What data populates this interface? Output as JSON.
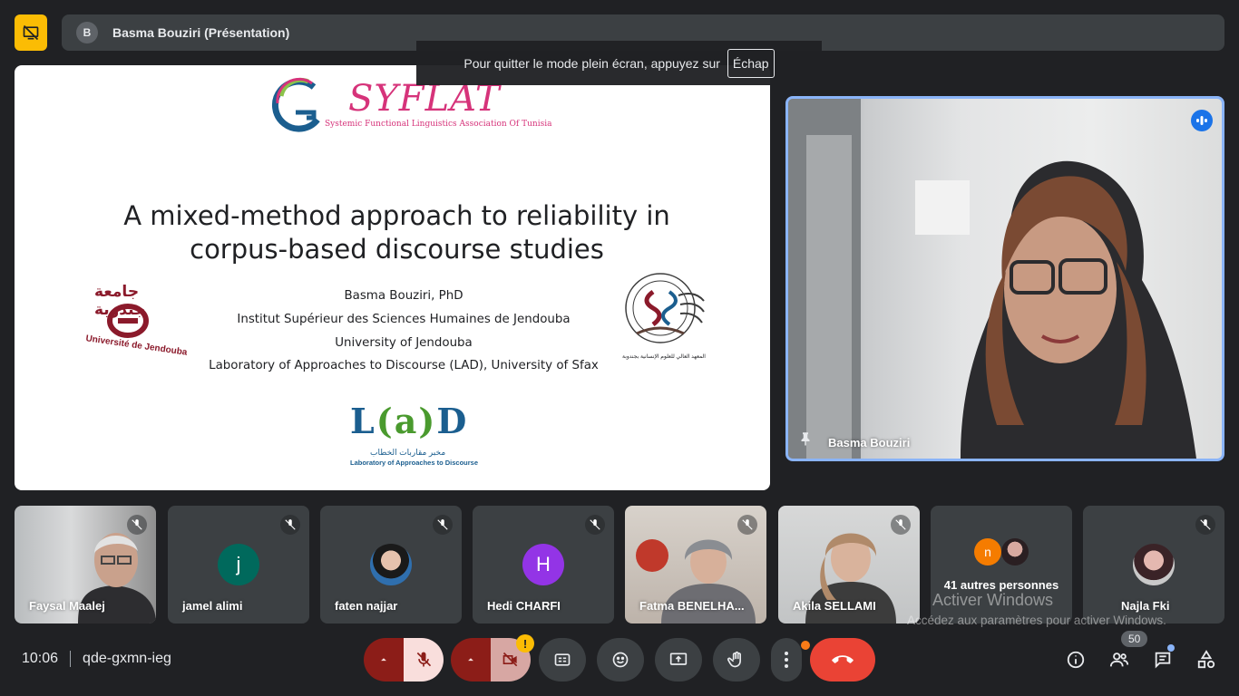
{
  "header": {
    "presenter_initial": "B",
    "presentation_title": "Basma Bouziri (Présentation)"
  },
  "fullscreen_toast": {
    "message": "Pour quitter le mode plein écran, appuyez sur",
    "key": "Échap"
  },
  "slide": {
    "logo_syflat_word": "SYFLAT",
    "logo_syflat_sub": "Systemic Functional Linguistics Association Of Tunisia",
    "title_line1": "A mixed-method approach to reliability in",
    "title_line2": "corpus-based discourse studies",
    "author": "Basma Bouziri, PhD",
    "affiliation1": "Institut Supérieur des Sciences Humaines de Jendouba",
    "affiliation2": "University of Jendouba",
    "affiliation3": "Laboratory of Approaches to Discourse (LAD), University of Sfax",
    "logo_uj_ar": "جامعة جندوبة",
    "logo_uj_fr": "Université de Jendouba",
    "logo_lad_ar": "مخبر مقاربات الخطاب",
    "logo_lad_en": "Laboratory of Approaches to Discourse",
    "logo_isshj_ar": "المعهد العالي للعلوم الإنسانية بجندوبة"
  },
  "speaker": {
    "name": "Basma Bouziri"
  },
  "participants": [
    {
      "name": "Faysal Maalej",
      "type": "video"
    },
    {
      "name": "jamel alimi",
      "initial": "j",
      "color": "#00695c"
    },
    {
      "name": "faten najjar",
      "type": "photo"
    },
    {
      "name": "Hedi CHARFI",
      "initial": "H",
      "color": "#9334e6"
    },
    {
      "name": "Fatma BENELHA...",
      "type": "video"
    },
    {
      "name": "Akila SELLAMI",
      "type": "video"
    },
    {
      "others_label": "41 autres personnes",
      "mini_initial": "n",
      "mini_color": "#f57c00"
    },
    {
      "name": "Najla Fki",
      "type": "photo"
    }
  ],
  "watermark": {
    "title": "Activer Windows",
    "subtitle": "Accédez aux paramètres pour activer Windows."
  },
  "meeting": {
    "time": "10:06",
    "code": "qde-gxmn-ieg",
    "participant_count": "50"
  },
  "colors": {
    "background": "#202124",
    "tile": "#3c4043",
    "accent_blue": "#8ab4f8",
    "end_call": "#ea4335",
    "mic_off": "#f9dedc",
    "mic_off_dark": "#8c1d18",
    "warning": "#fbbc04"
  },
  "icons": [
    "present-stop-icon",
    "fullscreen-exit",
    "mic-off-icon",
    "camera-off-icon",
    "captions-icon",
    "emoji-icon",
    "present-screen-icon",
    "raise-hand-icon",
    "more-vert-icon",
    "call-end-icon",
    "info-icon",
    "people-icon",
    "chat-icon",
    "activities-icon",
    "pin-icon",
    "speaking-icon"
  ]
}
